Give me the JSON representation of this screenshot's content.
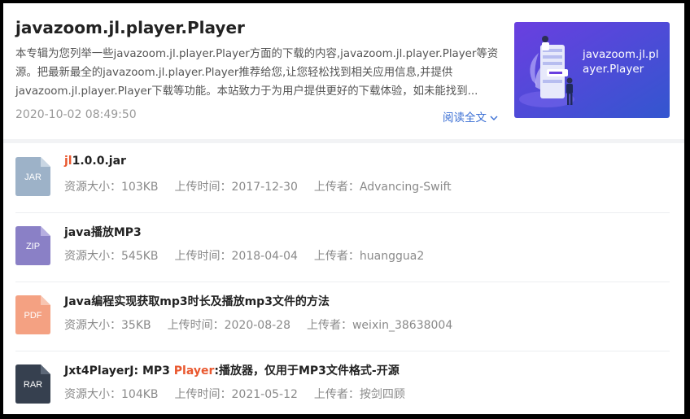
{
  "header": {
    "title": "javazoom.jl.player.Player",
    "description": "本专辑为您列举一些javazoom.jl.player.Player方面的下载的内容,javazoom.jl.player.Player等资源。把最新最全的javazoom.jl.player.Player推荐给您,让您轻松找到相关应用信息,并提供javazoom.jl.player.Player下载等功能。本站致力于为用户提供更好的下载体验，如未能找到...",
    "date": "2020-10-02 08:49:50",
    "read_more": "阅读全文",
    "banner_text": "javazoom.jl.player.Player"
  },
  "colors": {
    "accent": "#3b6fd4",
    "highlight": "#e9582f",
    "jar": "#9db2c8",
    "zip": "#8a80c6",
    "pdf": "#f4a182",
    "rar": "#36404f"
  },
  "meta_labels": {
    "size": "资源大小：",
    "time": "上传时间：",
    "uploader": "上传者："
  },
  "items": [
    {
      "type": "JAR",
      "icon": "jar-file-icon",
      "title_hl": "jl",
      "title_rest": "1.0.0.jar",
      "size": "103KB",
      "time": "2017-12-30",
      "uploader": "Advancing-Swift"
    },
    {
      "type": "ZIP",
      "icon": "zip-file-icon",
      "title_pre": "java播放MP3",
      "size": "545KB",
      "time": "2018-04-04",
      "uploader": "huanggua2"
    },
    {
      "type": "PDF",
      "icon": "pdf-file-icon",
      "title_pre": "Java编程实现获取mp3时长及播放mp3文件的方法",
      "size": "35KB",
      "time": "2020-08-28",
      "uploader": "weixin_38638004"
    },
    {
      "type": "RAR",
      "icon": "rar-file-icon",
      "title_pre": "Jxt4PlayerJ: MP3 ",
      "title_hl": "Player",
      "title_post": ":播放器，仅用于MP3文件格式-开源",
      "size": "104KB",
      "time": "2021-05-12",
      "uploader": "按剑四顾"
    }
  ]
}
